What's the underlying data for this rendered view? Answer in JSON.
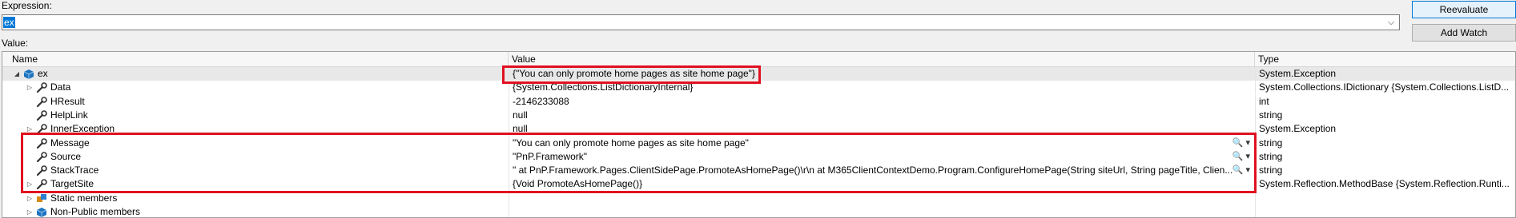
{
  "expression": {
    "label": "Expression:",
    "value": "ex",
    "dropdown_glyph": "⌵"
  },
  "buttons": {
    "reevaluate": "Reevaluate",
    "add_watch": "Add Watch"
  },
  "value_label": "Value:",
  "columns": {
    "name": "Name",
    "value": "Value",
    "type": "Type"
  },
  "rows": [
    {
      "name": "ex",
      "value": "{\"You can only promote home pages as site home page\"}",
      "type": "System.Exception",
      "expander": "◢",
      "icon": "object-icon"
    },
    {
      "name": "Data",
      "value": "{System.Collections.ListDictionaryInternal}",
      "type": "System.Collections.IDictionary {System.Collections.ListD...",
      "expander": "▷",
      "icon": "wrench-icon"
    },
    {
      "name": "HResult",
      "value": "-2146233088",
      "type": "int",
      "expander": "",
      "icon": "wrench-icon"
    },
    {
      "name": "HelpLink",
      "value": "null",
      "type": "string",
      "expander": "",
      "icon": "wrench-icon"
    },
    {
      "name": "InnerException",
      "value": "null",
      "type": "System.Exception",
      "expander": "▷",
      "icon": "wrench-icon"
    },
    {
      "name": "Message",
      "value": "\"You can only promote home pages as site home page\"",
      "type": "string",
      "expander": "",
      "icon": "wrench-icon",
      "tools": "🔍 ▾"
    },
    {
      "name": "Source",
      "value": "\"PnP.Framework\"",
      "type": "string",
      "expander": "",
      "icon": "wrench-icon",
      "tools": "🔍 ▾"
    },
    {
      "name": "StackTrace",
      "value": "\"   at PnP.Framework.Pages.ClientSidePage.PromoteAsHomePage()\\r\\n   at M365ClientContextDemo.Program.ConfigureHomePage(String siteUrl, String pageTitle, Clien...",
      "type": "string",
      "expander": "",
      "icon": "wrench-icon",
      "tools": "🔍 ▾"
    },
    {
      "name": "TargetSite",
      "value": "{Void PromoteAsHomePage()}",
      "type": "System.Reflection.MethodBase {System.Reflection.Runti...",
      "expander": "▷",
      "icon": "wrench-icon"
    },
    {
      "name": "Static members",
      "value": "",
      "type": "",
      "expander": "▷",
      "icon": "static-members-icon"
    },
    {
      "name": "Non-Public members",
      "value": "",
      "type": "",
      "expander": "▷",
      "icon": "object-icon"
    }
  ]
}
